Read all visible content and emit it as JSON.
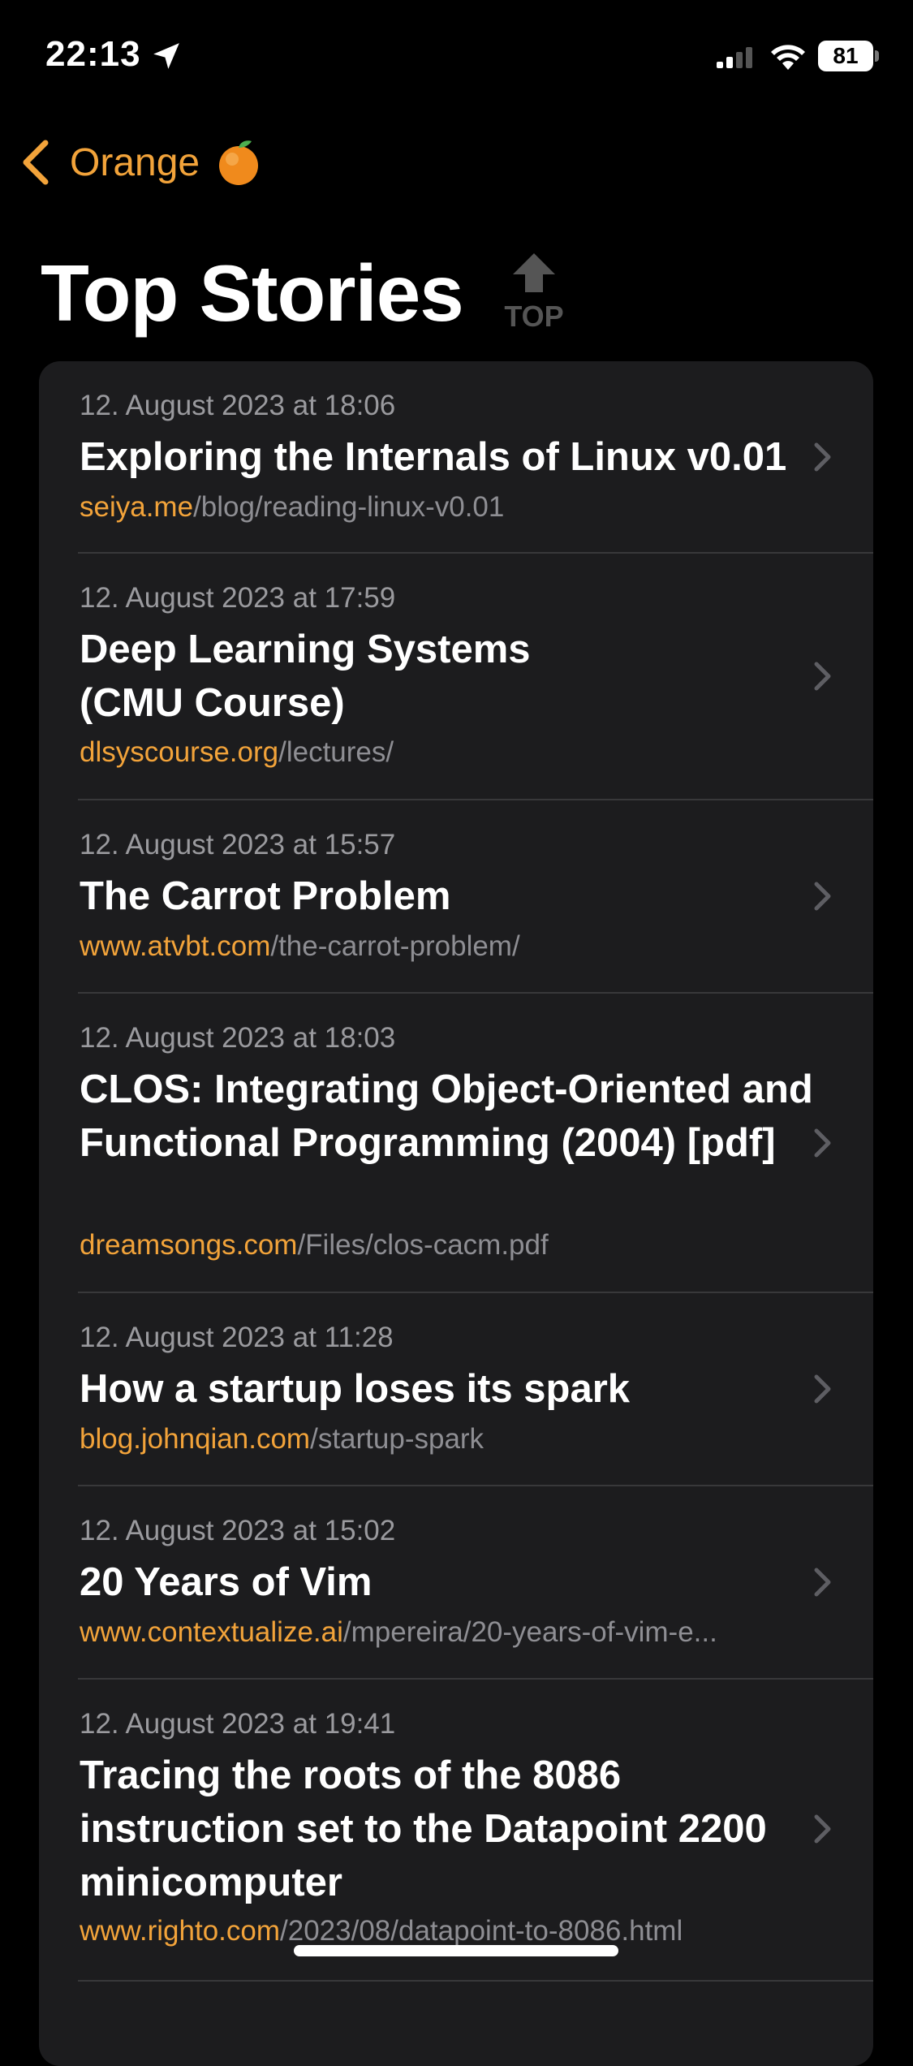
{
  "status": {
    "time": "22:13",
    "battery": "81"
  },
  "nav": {
    "back_label": "Orange",
    "emoji": "🍊"
  },
  "header": {
    "title": "Top Stories",
    "top_badge": "TOP"
  },
  "stories": [
    {
      "date": "12. August 2023 at 18:06",
      "title": "Exploring the Internals of Linux v0.01",
      "domain": "seiya.me",
      "path": "/blog/reading-linux-v0.01"
    },
    {
      "date": "12. August 2023 at 17:59",
      "title": "Deep Learning Systems\n(CMU Course)",
      "domain": "dlsyscourse.org",
      "path": "/lectures/"
    },
    {
      "date": "12. August 2023 at 15:57",
      "title": "The Carrot Problem",
      "domain": "www.atvbt.com",
      "path": "/the-carrot-problem/"
    },
    {
      "date": "12. August 2023 at 18:03",
      "title": "CLOS: Integrating Object-Oriented and Functional Programming (2004) [pdf]",
      "domain": "dreamsongs.com",
      "path": "/Files/clos-cacm.pdf"
    },
    {
      "date": "12. August 2023 at 11:28",
      "title": "How a startup loses its spark",
      "domain": "blog.johnqian.com",
      "path": "/startup-spark"
    },
    {
      "date": "12. August 2023 at 15:02",
      "title": "20 Years of Vim",
      "domain": "www.contextualize.ai",
      "path": "/mpereira/20-years-of-vim-e..."
    },
    {
      "date": "12. August 2023 at 19:41",
      "title": "Tracing the roots of the 8086 instruction set to the Datapoint 2200 minicomputer",
      "domain": "www.righto.com",
      "path": "/2023/08/datapoint-to-8086.html"
    }
  ],
  "colors": {
    "accent": "#f2a33a",
    "card": "#1c1c1e",
    "background": "#000000",
    "secondary_text": "#9a9a9e"
  }
}
